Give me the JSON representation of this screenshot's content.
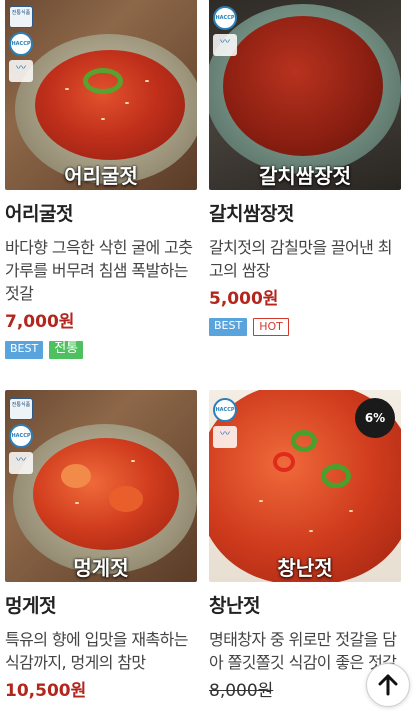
{
  "products": [
    {
      "image_caption": "어리굴젓",
      "name": "어리굴젓",
      "description": "바다향 그윽한 삭힌 굴에 고춧가루를 버무려 침샘 폭발하는 젓갈",
      "price": "7,000원",
      "tags": [
        "BEST",
        "전통"
      ]
    },
    {
      "image_caption": "갈치쌈장젓",
      "name": "갈치쌈장젓",
      "description": "갈치젓의 감칠맛을 끌어낸 최고의 쌈장",
      "price": "5,000원",
      "tags": [
        "BEST",
        "HOT"
      ]
    },
    {
      "image_caption": "멍게젓",
      "name": "멍게젓",
      "description": "특유의 향에 입맛을 재촉하는 식감까지, 멍게의 참맛",
      "price": "10,500원"
    },
    {
      "image_caption": "창난젓",
      "name": "창난젓",
      "description": "명태창자 중 위로만 젓갈을 담아 쫄깃쫄깃 식감이 좋은 젓갈",
      "price_original": "8,000원",
      "discount": "6%"
    }
  ],
  "badges": {
    "cert": "전통식품",
    "haccp": "HACCP"
  },
  "icons": {
    "scroll_top": "arrow-up-icon"
  },
  "colors": {
    "price": "#b3261e",
    "tag_best": "#5aa4dd",
    "tag_traditional": "#4fc060",
    "tag_hot": "#d33a2c"
  }
}
